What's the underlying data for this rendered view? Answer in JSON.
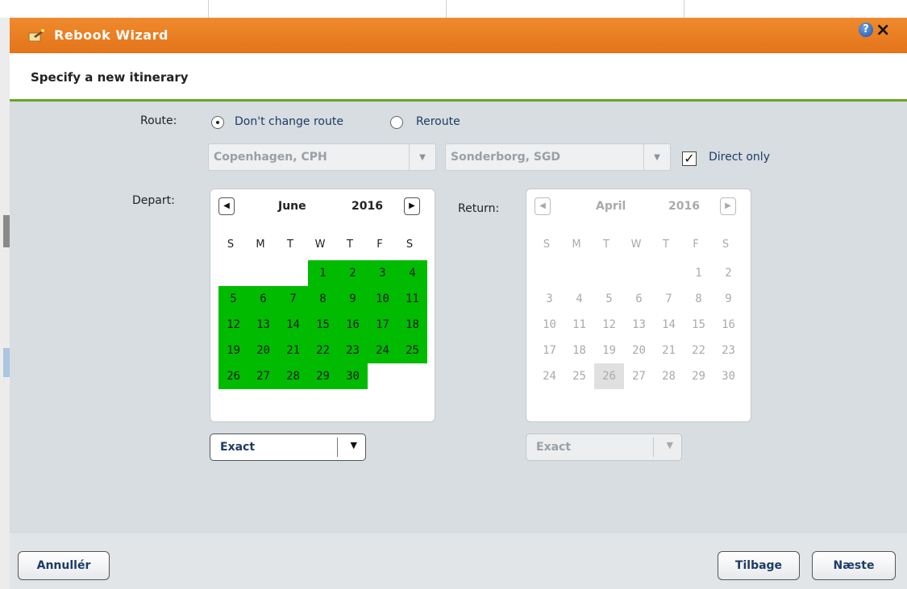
{
  "window": {
    "title": "Rebook Wizard"
  },
  "subheader": {
    "title": "Specify a new itinerary"
  },
  "route": {
    "label": "Route:",
    "options": [
      "Don't change route",
      "Reroute"
    ],
    "selected": "Don't change route",
    "origin": "Copenhagen, CPH",
    "destination": "Sonderborg, SGD",
    "direct_only_label": "Direct only",
    "direct_only_checked": true
  },
  "depart": {
    "label": "Depart:",
    "month": "June",
    "year": "2016",
    "weekdays": [
      "S",
      "M",
      "T",
      "W",
      "T",
      "F",
      "S"
    ],
    "weeks": [
      [
        "",
        "",
        "",
        "1",
        "2",
        "3",
        "4"
      ],
      [
        "5",
        "6",
        "7",
        "8",
        "9",
        "10",
        "11"
      ],
      [
        "12",
        "13",
        "14",
        "15",
        "16",
        "17",
        "18"
      ],
      [
        "19",
        "20",
        "21",
        "22",
        "23",
        "24",
        "25"
      ],
      [
        "26",
        "27",
        "28",
        "29",
        "30",
        "",
        ""
      ]
    ],
    "mode": "Exact"
  },
  "return": {
    "label": "Return:",
    "month": "April",
    "year": "2016",
    "weekdays": [
      "S",
      "M",
      "T",
      "W",
      "T",
      "F",
      "S"
    ],
    "weeks": [
      [
        "",
        "",
        "",
        "",
        "",
        "1",
        "2"
      ],
      [
        "3",
        "4",
        "5",
        "6",
        "7",
        "8",
        "9"
      ],
      [
        "10",
        "11",
        "12",
        "13",
        "14",
        "15",
        "16"
      ],
      [
        "17",
        "18",
        "19",
        "20",
        "21",
        "22",
        "23"
      ],
      [
        "24",
        "25",
        "26",
        "27",
        "28",
        "29",
        "30"
      ]
    ],
    "highlighted_day": "26",
    "mode": "Exact"
  },
  "buttons": {
    "cancel": "Annullér",
    "back": "Tilbage",
    "next": "Næste"
  },
  "colors": {
    "titlebar": "#e87c22",
    "available_day": "#00bb00",
    "divider": "#6aa524"
  }
}
